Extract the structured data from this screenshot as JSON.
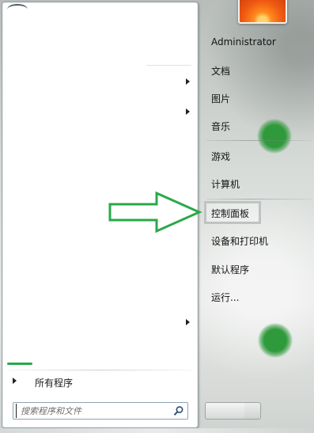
{
  "start_menu": {
    "left_panel": {
      "all_programs_label": "所有程序",
      "search": {
        "placeholder": "搜索程序和文件"
      }
    },
    "right_panel": {
      "user_name": "Administrator",
      "items": [
        {
          "label": "文档"
        },
        {
          "label": "图片"
        },
        {
          "label": "音乐"
        },
        {
          "label": "游戏"
        },
        {
          "label": "计算机"
        },
        {
          "label": "控制面板",
          "highlighted": true
        },
        {
          "label": "设备和打印机"
        },
        {
          "label": "默认程序"
        },
        {
          "label": "运行..."
        }
      ]
    },
    "annotation": {
      "arrow_color": "#2aa84a",
      "highlight_color": "#bfc3c1"
    }
  }
}
